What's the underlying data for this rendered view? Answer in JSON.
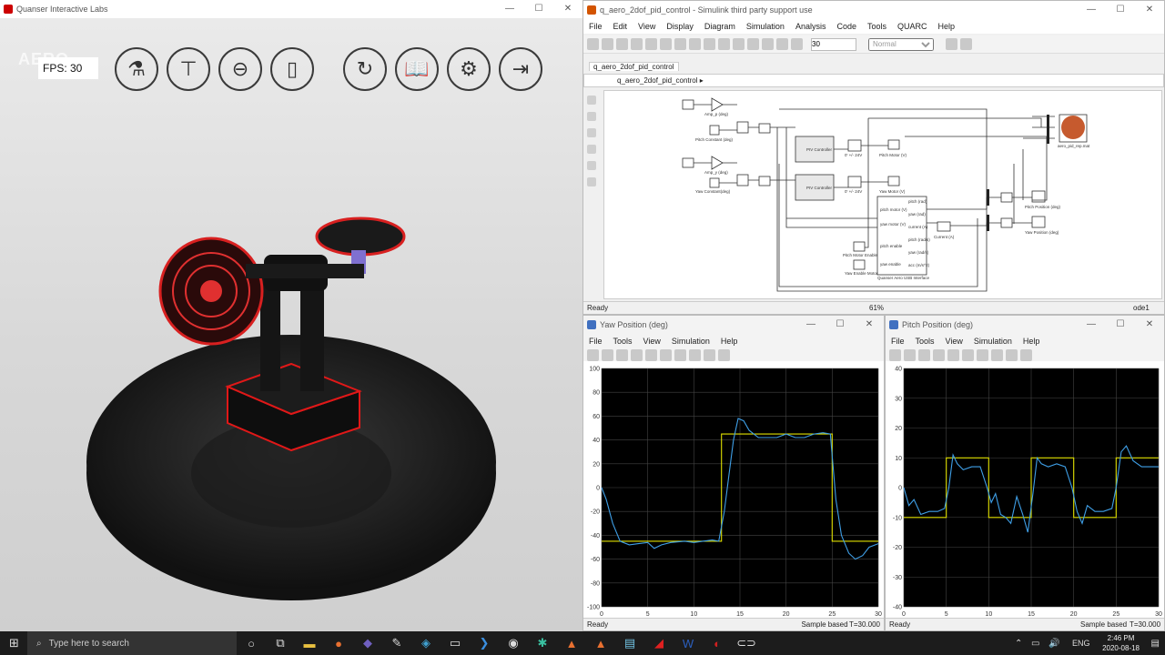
{
  "quanser": {
    "title": "Quanser Interactive Labs",
    "fps": "FPS: 30",
    "logo": "AERO",
    "buttons": [
      "aero-icon",
      "hover-icon",
      "propeller-icon",
      "phone-icon",
      "reset-icon",
      "book-icon",
      "gear-icon",
      "exit-icon"
    ]
  },
  "simulink": {
    "title": "q_aero_2dof_pid_control - Simulink third party support use",
    "menu": [
      "File",
      "Edit",
      "View",
      "Display",
      "Diagram",
      "Simulation",
      "Analysis",
      "Code",
      "Tools",
      "QUARC",
      "Help"
    ],
    "stop_time": "30",
    "mode": "Normal",
    "tab": "q_aero_2dof_pid_control",
    "breadcrumb": "q_aero_2dof_pid_control",
    "status_left": "Ready",
    "zoom": "61%",
    "solver": "ode1",
    "blocks": {
      "amp_p": "Amp_p (deg)",
      "pitch_const": "Pitch Constant (deg)",
      "amp_y": "Amp_y (deg)",
      "yaw_const": "Yaw Constant(deg)",
      "pid": "PIV\nController",
      "sat_p": "0' +/- 24V",
      "sat_y": "0' +/- 24V",
      "pitch_motor": "Pitch Motor (V)",
      "yaw_motor": "Yaw Motor (V)",
      "pitch_enable": "Pitch Motor Enable",
      "yaw_enable": "Yaw Enable Motor",
      "interface": "Quanser Aero USB Interface",
      "current": "Current (A)",
      "pitch_pos": "Pitch Position (deg)",
      "yaw_pos": "Yaw Position (deg)",
      "hdd": "aero_pid_rep.mat",
      "port1": "pitch motor (V)",
      "port2": "yaw motor (V)",
      "port3": "pitch enable",
      "port4": "yaw enable",
      "out1": "pitch (rad)",
      "out2": "yaw (rad)",
      "out3": "current (A)",
      "out4": "pitch (rad/s)",
      "out5": "yaw (rad/s)",
      "out6": "acc (m/s^2)"
    }
  },
  "yaw_scope": {
    "title": "Yaw Position (deg)",
    "menu": [
      "File",
      "Tools",
      "View",
      "Simulation",
      "Help"
    ],
    "status_left": "Ready",
    "status_mid": "Sample based",
    "status_right": "T=30.000"
  },
  "pitch_scope": {
    "title": "Pitch Position (deg)",
    "menu": [
      "File",
      "Tools",
      "View",
      "Simulation",
      "Help"
    ],
    "status_left": "Ready",
    "status_mid": "Sample based",
    "status_right": "T=30.000"
  },
  "chart_data": [
    {
      "type": "line",
      "title": "",
      "xlim": [
        0,
        30
      ],
      "ylim": [
        -100,
        100
      ],
      "xticks": [
        0,
        5,
        10,
        15,
        20,
        25,
        30
      ],
      "yticks": [
        100,
        80,
        60,
        40,
        20,
        0,
        -20,
        -40,
        -60,
        -80,
        -100
      ],
      "grid": true,
      "series": [
        {
          "color": "#e0e000",
          "x": [
            0,
            13,
            13,
            25,
            25,
            30
          ],
          "y": [
            -45,
            -45,
            45,
            45,
            -45,
            -45
          ]
        },
        {
          "color": "#3fa0e8",
          "x": [
            0,
            0.5,
            1.2,
            2,
            3,
            4,
            5,
            5.7,
            6.5,
            7.5,
            9,
            10,
            11,
            12,
            12.7,
            13.3,
            13.8,
            14.3,
            14.8,
            15.4,
            16,
            17,
            18,
            19,
            20,
            21,
            22,
            23,
            24,
            24.8,
            25.4,
            26,
            26.8,
            27.5,
            28.3,
            29,
            30
          ],
          "y": [
            0,
            -10,
            -30,
            -45,
            -48,
            -47,
            -46,
            -51,
            -48,
            -46,
            -45,
            -46,
            -45,
            -44,
            -45,
            -20,
            10,
            40,
            58,
            56,
            48,
            42,
            42,
            42,
            45,
            42,
            42,
            45,
            46,
            45,
            -10,
            -40,
            -55,
            -60,
            -57,
            -50,
            -47
          ]
        }
      ]
    },
    {
      "type": "line",
      "title": "",
      "xlim": [
        0,
        30
      ],
      "ylim": [
        -40,
        40
      ],
      "xticks": [
        0,
        5,
        10,
        15,
        20,
        25,
        30
      ],
      "yticks": [
        40,
        30,
        20,
        10,
        0,
        -10,
        -20,
        -30,
        -40
      ],
      "grid": true,
      "series": [
        {
          "color": "#e0e000",
          "x": [
            0,
            5,
            5,
            10,
            10,
            15,
            15,
            20,
            20,
            25,
            25,
            30
          ],
          "y": [
            -10,
            -10,
            10,
            10,
            -10,
            -10,
            10,
            10,
            -10,
            -10,
            10,
            10
          ]
        },
        {
          "color": "#3fa0e8",
          "x": [
            0,
            0.6,
            1.2,
            2,
            3,
            4,
            4.8,
            5.3,
            5.8,
            6.3,
            7,
            8,
            9,
            9.8,
            10.3,
            10.8,
            11.4,
            12,
            12.6,
            13.3,
            14,
            14.6,
            15.2,
            15.7,
            16.2,
            17,
            18,
            19,
            19.8,
            20.4,
            21,
            21.6,
            22.5,
            23.5,
            24.5,
            25,
            25.6,
            26.2,
            27,
            28,
            29,
            30
          ],
          "y": [
            0,
            -6,
            -4,
            -9,
            -8,
            -8,
            -7,
            0,
            11,
            8,
            6,
            7,
            7,
            0,
            -5,
            -2,
            -9,
            -10,
            -12,
            -3,
            -9,
            -15,
            -2,
            10,
            8,
            7,
            8,
            7,
            0,
            -8,
            -12,
            -6,
            -8,
            -8,
            -7,
            0,
            12,
            14,
            9,
            7,
            7,
            7
          ]
        }
      ]
    }
  ],
  "taskbar": {
    "search": "Type here to search",
    "lang": "ENG",
    "time": "2:46 PM",
    "date": "2020-08-18"
  }
}
